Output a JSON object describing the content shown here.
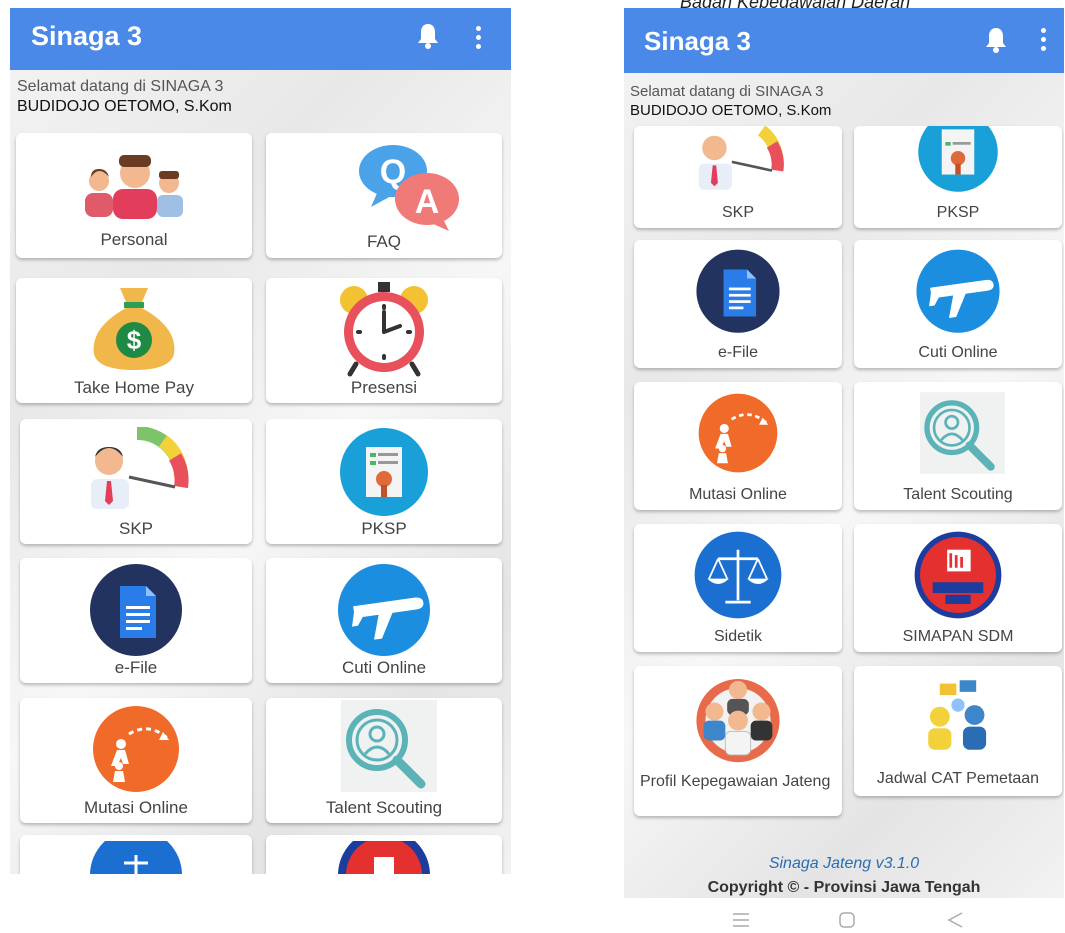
{
  "top_caption": "Badan Kepegawaian Daerah",
  "app": {
    "title": "Sinaga 3",
    "welcome_line": "Selamat datang di SINAGA 3",
    "user_name": "BUDIDOJO OETOMO, S.Kom",
    "bell_icon": "bell-icon",
    "menu_icon": "kebab-menu-icon",
    "accent_color": "#4a89e8"
  },
  "menu": {
    "personal": "Personal",
    "faq": "FAQ",
    "take_home_pay": "Take Home Pay",
    "presensi": "Presensi",
    "skp": "SKP",
    "pksp": "PKSP",
    "efile": "e-File",
    "cuti": "Cuti Online",
    "mutasi": "Mutasi Online",
    "talent": "Talent Scouting",
    "sidetik": "Sidetik",
    "simapan": "SIMAPAN SDM",
    "profil": "Profil Kepegawaian Jateng",
    "jadwal": "Jadwal CAT Pemetaan"
  },
  "footer": {
    "version": "Sinaga Jateng v3.1.0",
    "copyright": "Copyright © - Provinsi Jawa Tengah"
  },
  "nav_icons": [
    "menu-icon",
    "home-icon",
    "back-icon"
  ]
}
